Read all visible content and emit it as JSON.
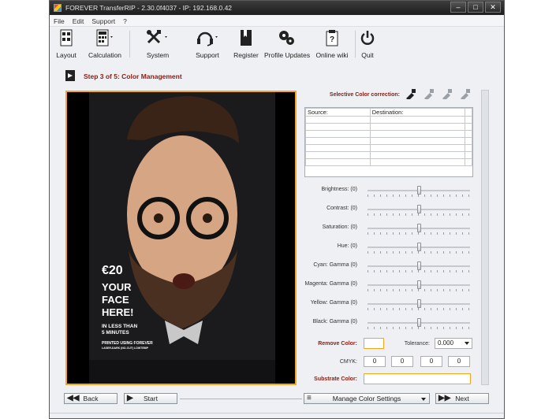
{
  "window": {
    "title": "FOREVER TransferRIP - 2.30.0f4037 - IP: 192.168.0.42",
    "controls": [
      "–",
      "□",
      "✕"
    ]
  },
  "menu": [
    "File",
    "Edit",
    "Support",
    "?"
  ],
  "toolbar": [
    {
      "label": "Layout",
      "icon": "layout-icon"
    },
    {
      "label": "Calculation",
      "icon": "calculator-icon"
    },
    {
      "label": "System",
      "icon": "tools-icon"
    },
    {
      "label": "Support",
      "icon": "headset-icon"
    },
    {
      "label": "Register",
      "icon": "register-icon"
    },
    {
      "label": "Profile Updates",
      "icon": "gears-icon"
    },
    {
      "label": "Online wiki",
      "icon": "wiki-icon"
    },
    {
      "label": "Quit",
      "icon": "power-icon"
    }
  ],
  "step": {
    "title": "Step 3 of 5: Color Management"
  },
  "poster": {
    "price": "€20",
    "line1": "YOUR",
    "line2": "FACE",
    "line3": "HERE!",
    "line4": "IN LESS THAN",
    "line5": "5 MINUTES",
    "line6": "PRINTED USING FOREVER",
    "line7": "LASER-DARK (NO-CUT) LOWTEMP"
  },
  "color_correction": {
    "label": "Selective Color correction:",
    "columns": [
      "Source:",
      "Destination:",
      ""
    ],
    "rows": 7
  },
  "sliders": [
    {
      "label": "Brightness: (0)",
      "level": 0.5
    },
    {
      "label": "Contrast: (0)",
      "level": 0.5
    },
    {
      "label": "Saturation: (0)",
      "level": 0.5
    },
    {
      "label": "Hue: (0)",
      "level": 0.5
    },
    {
      "label": "Cyan: Gamma (0)",
      "level": 0.5
    },
    {
      "label": "Magenta: Gamma (0)",
      "level": 0.5
    },
    {
      "label": "Yellow: Gamma (0)",
      "level": 0.5
    },
    {
      "label": "Black: Gamma (0)",
      "level": 0.5
    }
  ],
  "remove_color": {
    "label": "Remove Color:"
  },
  "tolerance": {
    "label": "Tolerance:",
    "value": "0.000"
  },
  "cmyk": {
    "label": "CMYK:",
    "values": [
      "0",
      "0",
      "0",
      "0"
    ]
  },
  "substrate": {
    "label": "Substrate Color:"
  },
  "buttons": {
    "back": "Back",
    "start": "Start",
    "manage": "Manage Color Settings",
    "next": "Next"
  },
  "colors": {
    "accent": "#f2a71f",
    "heading": "#8b1c13"
  }
}
